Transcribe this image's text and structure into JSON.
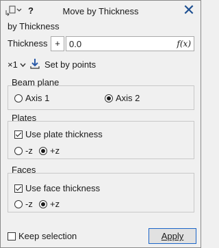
{
  "window": {
    "title": "Move by Thickness"
  },
  "toolbar": {
    "help_label": "?"
  },
  "section": {
    "title": "by Thickness"
  },
  "thickness": {
    "label": "Thickness",
    "sign": "+",
    "value": "0.0",
    "fx_label": "f(x)"
  },
  "multiplier": {
    "label": "×1"
  },
  "set_by_points": {
    "label": "Set by points"
  },
  "beam_plane": {
    "title": "Beam plane",
    "options": [
      {
        "label": "Axis 1",
        "selected": false
      },
      {
        "label": "Axis 2",
        "selected": true
      }
    ]
  },
  "plates": {
    "title": "Plates",
    "use_label": "Use plate thickness",
    "use_checked": true,
    "options": [
      {
        "label": "-z",
        "selected": false
      },
      {
        "label": "+z",
        "selected": true
      }
    ]
  },
  "faces": {
    "title": "Faces",
    "use_label": "Use face thickness",
    "use_checked": true,
    "options": [
      {
        "label": "-z",
        "selected": false
      },
      {
        "label": "+z",
        "selected": true
      }
    ]
  },
  "footer": {
    "keep_selection_label": "Keep selection",
    "keep_selection_checked": false,
    "apply_label": "Apply"
  },
  "colors": {
    "accent": "#1a64c8",
    "close": "#1d4f91",
    "arrow": "#2a5aa8"
  }
}
